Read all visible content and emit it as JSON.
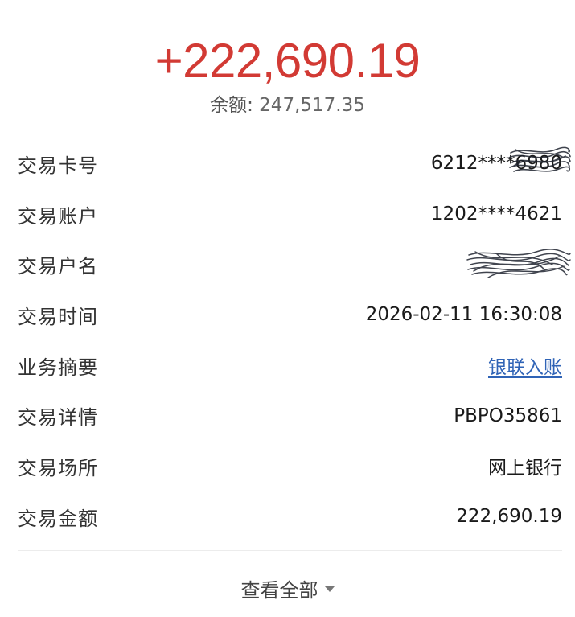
{
  "header": {
    "amount": "+222,690.19",
    "balance_label": "余额:",
    "balance_value": "247,517.35"
  },
  "details": [
    {
      "label": "交易卡号",
      "value": "6212****6980",
      "redacted": true
    },
    {
      "label": "交易账户",
      "value": "1202****4621"
    },
    {
      "label": "交易户名",
      "value": "",
      "redacted": true
    },
    {
      "label": "交易时间",
      "value": "2026-02-11 16:30:08"
    },
    {
      "label": "业务摘要",
      "value": "银联入账",
      "link": true
    },
    {
      "label": "交易详情",
      "value": "PBPO35861"
    },
    {
      "label": "交易场所",
      "value": "网上银行"
    },
    {
      "label": "交易金额",
      "value": "222,690.19"
    }
  ],
  "footer": {
    "view_all_label": "查看全部",
    "icon": "caret-down-icon"
  },
  "colors": {
    "amount": "#d23a34",
    "link": "#2f63b6",
    "redaction_ink": "#1f2430"
  }
}
